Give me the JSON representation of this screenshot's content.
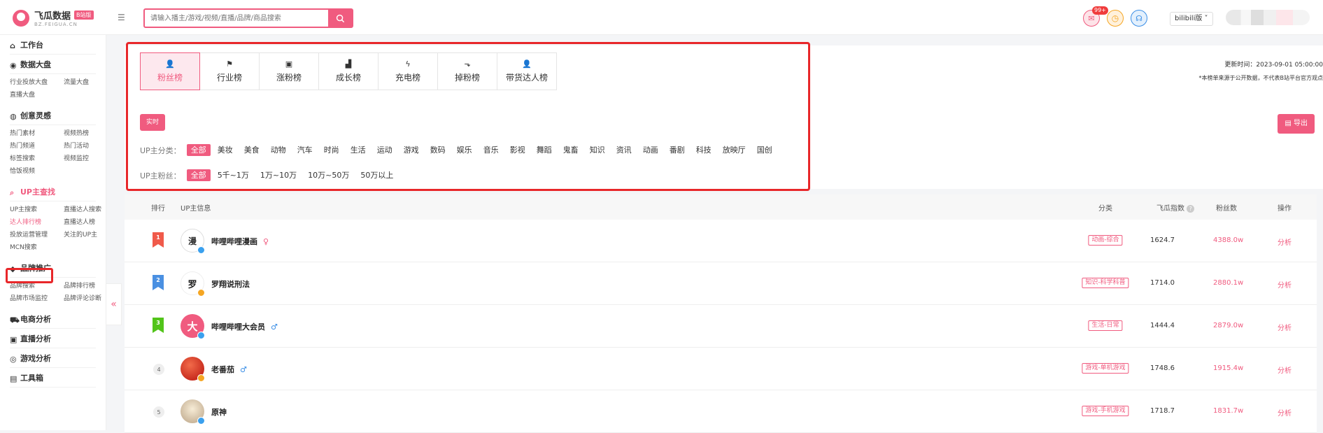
{
  "brand": {
    "name": "飞瓜数据",
    "badge": "B站版",
    "sub": "BZ.FEIGUA.CN"
  },
  "search": {
    "placeholder": "请输入播主/游戏/视频/直播/品牌/商品搜索"
  },
  "header": {
    "notif_count": "99+",
    "platform": "bilibili版 ˅"
  },
  "sidebar": {
    "workbench": "工作台",
    "sections": [
      {
        "title": "数据大盘",
        "items": [
          "行业投放大盘",
          "流量大盘",
          "直播大盘"
        ]
      },
      {
        "title": "创意灵感",
        "items": [
          "热门素材",
          "视频热榜",
          "热门频道",
          "热门活动",
          "标签搜索",
          "视频监控",
          "恰饭视频"
        ]
      },
      {
        "title": "UP主查找",
        "items": [
          "UP主搜索",
          "直播达人搜索",
          "达人排行榜",
          "直播达人榜",
          "投放运营管理",
          "关注的UP主",
          "MCN搜索"
        ]
      },
      {
        "title": "品牌推广",
        "items": [
          "品牌搜索",
          "品牌排行榜",
          "品牌市场监控",
          "品牌评论诊断"
        ]
      }
    ],
    "singles": [
      "电商分析",
      "直播分析",
      "游戏分析",
      "工具箱"
    ],
    "collapse": "«"
  },
  "tabs": [
    {
      "label": "粉丝榜",
      "icon": "fans-icon",
      "glyph": "👤"
    },
    {
      "label": "行业榜",
      "icon": "flag-icon",
      "glyph": "⚑"
    },
    {
      "label": "涨粉榜",
      "icon": "bag-icon",
      "glyph": "▣"
    },
    {
      "label": "成长榜",
      "icon": "growth-icon",
      "glyph": "▟"
    },
    {
      "label": "充电榜",
      "icon": "charge-icon",
      "glyph": "ϟ"
    },
    {
      "label": "掉粉榜",
      "icon": "drop-icon",
      "glyph": "⬎"
    },
    {
      "label": "带货达人榜",
      "icon": "seller-icon",
      "glyph": "👤"
    }
  ],
  "update_time": "更新时间：2023-09-01 05:00:00",
  "data_note": "*本榜单来源于公开数据，不代表B站平台官方观点",
  "realtime": "实时",
  "export": "导出",
  "filters": {
    "category_label": "UP主分类：",
    "categories": [
      "全部",
      "美妆",
      "美食",
      "动物",
      "汽车",
      "时尚",
      "生活",
      "运动",
      "游戏",
      "数码",
      "娱乐",
      "音乐",
      "影视",
      "舞蹈",
      "鬼畜",
      "知识",
      "资讯",
      "动画",
      "番剧",
      "科技",
      "放映厅",
      "国创"
    ],
    "fans_label": "UP主粉丝：",
    "fans": [
      "全部",
      "5千~1万",
      "1万~10万",
      "10万~50万",
      "50万以上"
    ]
  },
  "table": {
    "headers": {
      "rank": "排行",
      "info": "UP主信息",
      "category": "分类",
      "score": "飞瓜指数",
      "score_help": "?",
      "fans": "粉丝数",
      "op": "操作"
    },
    "rows": [
      {
        "rank": "1",
        "name": "哔哩哔哩漫画",
        "gender": "♀",
        "category": "动画-综合",
        "score": "1624.7",
        "fans": "4388.0w",
        "op": "分析",
        "avatar": "漫"
      },
      {
        "rank": "2",
        "name": "罗翔说刑法",
        "gender": "",
        "category": "知识-科学科普",
        "score": "1714.0",
        "fans": "2880.1w",
        "op": "分析",
        "avatar": "罗"
      },
      {
        "rank": "3",
        "name": "哔哩哔哩大会员",
        "gender": "♂",
        "category": "生活-日常",
        "score": "1444.4",
        "fans": "2879.0w",
        "op": "分析",
        "avatar": "大"
      },
      {
        "rank": "4",
        "name": "老番茄",
        "gender": "♂",
        "category": "游戏-单机游戏",
        "score": "1748.6",
        "fans": "1915.4w",
        "op": "分析",
        "avatar": ""
      },
      {
        "rank": "5",
        "name": "原神",
        "gender": "",
        "category": "游戏-手机游戏",
        "score": "1718.7",
        "fans": "1831.7w",
        "op": "分析",
        "avatar": ""
      }
    ]
  },
  "colors": {
    "accent": "#f05b7f",
    "highlight_box": "#e8272a"
  }
}
